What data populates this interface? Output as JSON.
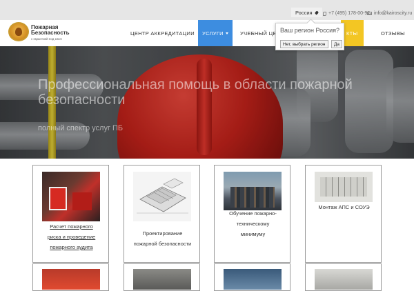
{
  "topbar": {
    "region": "Россия",
    "phone": "+7 (495) 178-00-92",
    "email": "info@kairoscity.ru"
  },
  "logo": {
    "title": "Пожарная Безопасность",
    "subtitle": "с гарантией под ключ"
  },
  "nav": {
    "items": [
      {
        "label": "ЦЕНТР АККРЕДИТАЦИИ"
      },
      {
        "label": "УСЛУГИ"
      },
      {
        "label": "УЧЕБНЫЙ ЦЕНТ"
      },
      {
        "label": "КТЫ"
      },
      {
        "label": "ОТЗЫВЫ"
      }
    ]
  },
  "region_popup": {
    "question": "Ваш регион Россия?",
    "no_button": "Нет, выбрать регион",
    "yes_button": "Да"
  },
  "hero": {
    "title": "Профессиональная помощь в области пожарной безопасности",
    "subtitle": "полный спектр услуг ПБ"
  },
  "services": [
    {
      "lines": [
        "Расчет пожарного",
        "риска и проведение",
        "пожарного аудита"
      ]
    },
    {
      "lines": [
        "Проектирование",
        "пожарной безопасности"
      ]
    },
    {
      "lines": [
        "Обучение пожарно-",
        "техническому",
        "минимуму"
      ]
    },
    {
      "lines": [
        "Монтаж АПС и СОУЭ"
      ]
    }
  ],
  "colors": {
    "nav_active": "#3d8de0",
    "nav_highlight": "#f3c623",
    "topbar_bg": "#e6e6e6"
  }
}
